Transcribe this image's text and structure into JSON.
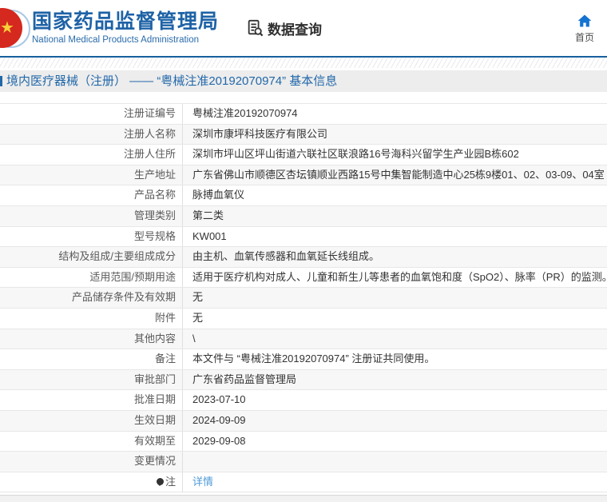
{
  "header": {
    "org_name_cn": "国家药品监督管理局",
    "org_name_en": "National Medical Products Administration",
    "data_query_label": "数据查询",
    "home_label": "首页"
  },
  "breadcrumb": {
    "text": "境内医疗器械（注册） ——  “粤械注准20192070974” 基本信息"
  },
  "detail_table": {
    "rows": [
      {
        "label": "注册证编号",
        "value": "粤械注准20192070974"
      },
      {
        "label": "注册人名称",
        "value": "深圳市康坪科技医疗有限公司"
      },
      {
        "label": "注册人住所",
        "value": "深圳市坪山区坪山街道六联社区联浪路16号海科兴留学生产业园B栋602"
      },
      {
        "label": "生产地址",
        "value": "广东省佛山市顺德区杏坛镇顺业西路15号中集智能制造中心25栋9楼01、02、03-09、04室"
      },
      {
        "label": "产品名称",
        "value": "脉搏血氧仪"
      },
      {
        "label": "管理类别",
        "value": "第二类"
      },
      {
        "label": "型号规格",
        "value": "KW001"
      },
      {
        "label": "结构及组成/主要组成成分",
        "value": "由主机、血氧传感器和血氧延长线组成。"
      },
      {
        "label": "适用范围/预期用途",
        "value": "适用于医疗机构对成人、儿童和新生儿等患者的血氧饱和度（SpO2）、脉率（PR）的监测。"
      },
      {
        "label": "产品储存条件及有效期",
        "value": "无"
      },
      {
        "label": "附件",
        "value": "无"
      },
      {
        "label": "其他内容",
        "value": "\\"
      },
      {
        "label": "备注",
        "value": "本文件与 “粤械注准20192070974” 注册证共同使用。"
      },
      {
        "label": "审批部门",
        "value": "广东省药品监督管理局"
      },
      {
        "label": "批准日期",
        "value": "2023-07-10"
      },
      {
        "label": "生效日期",
        "value": "2024-09-09"
      },
      {
        "label": "有效期至",
        "value": "2029-09-08"
      },
      {
        "label": "变更情况",
        "value": ""
      },
      {
        "label": "注",
        "value": "详情",
        "value_is_link": true,
        "label_icon": "note-balloon-icon"
      }
    ]
  },
  "icons": {
    "emblem": "national-emblem-icon",
    "data_query": "document-magnifier-icon",
    "home": "home-icon",
    "note": "note-balloon-icon"
  },
  "colors": {
    "brand_blue": "#1e62a6",
    "header_rule_blue": "#17609f",
    "breadcrumb_text_blue": "#2268a9",
    "breadcrumb_bg": "#ededed",
    "link_blue": "#4f9bd8",
    "home_icon_blue": "#1472d0",
    "emblem_red": "#d5281e",
    "emblem_gold": "#f8cf3a",
    "row_alt_bg": "#f7f7f7",
    "row_border": "#e7e7e7"
  }
}
